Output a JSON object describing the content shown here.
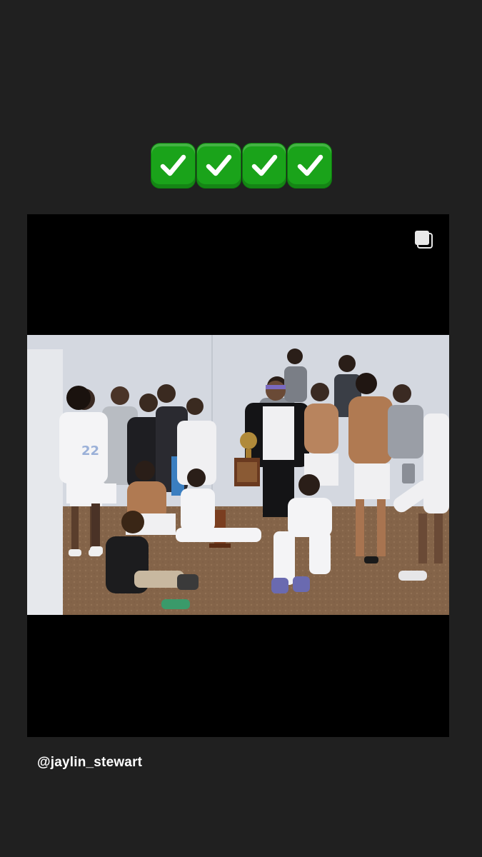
{
  "story": {
    "emoji": {
      "name": "white-heavy-check-mark",
      "count": 4,
      "color": "#1aa31a"
    },
    "post": {
      "multi_image": true,
      "icon": "carousel-stack-icon",
      "photo_description_icon": "team-celebration-photo"
    },
    "mention": {
      "username": "@jaylin_stewart"
    },
    "background_color": "#202020"
  }
}
